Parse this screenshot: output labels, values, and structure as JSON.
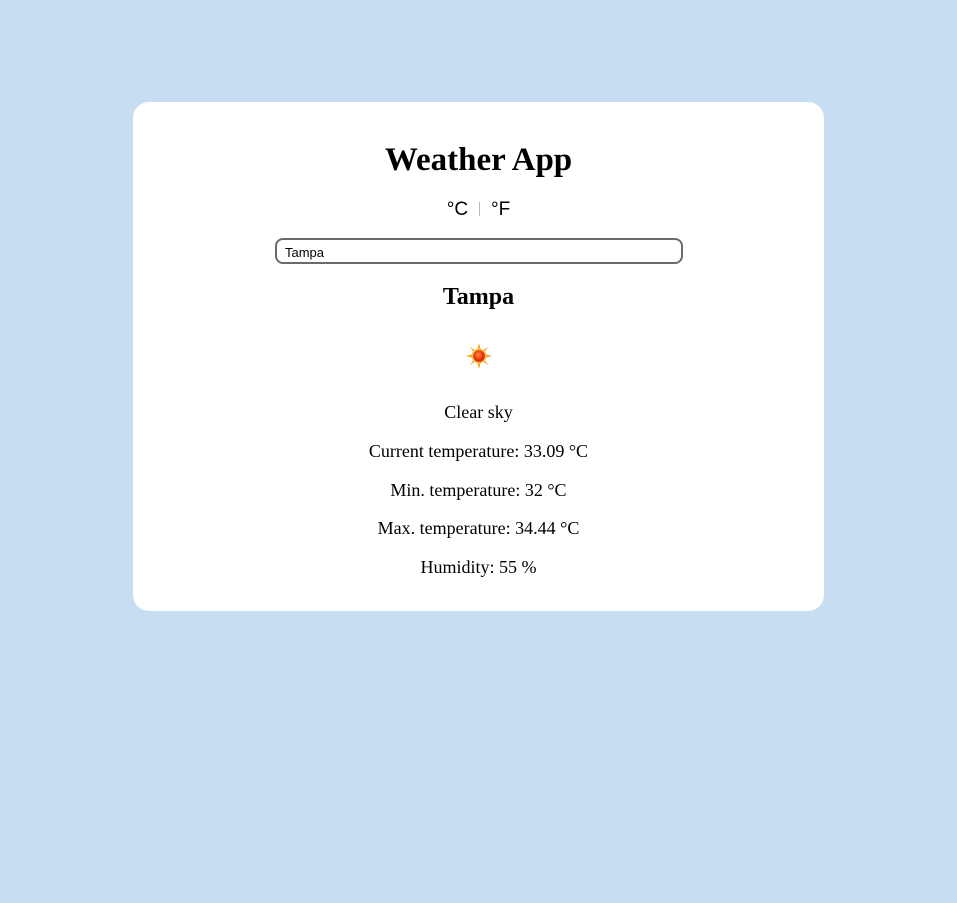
{
  "app": {
    "title": "Weather App"
  },
  "units": {
    "celsius_label": "°C",
    "fahrenheit_label": "°F"
  },
  "search": {
    "value": "Tampa",
    "placeholder": ""
  },
  "weather": {
    "city": "Tampa",
    "icon": "sun-icon",
    "description": "Clear sky",
    "current_temperature": "Current temperature: 33.09 °C",
    "min_temperature": "Min. temperature: 32 °C",
    "max_temperature": "Max. temperature: 34.44 °C",
    "humidity": "Humidity: 55 %"
  },
  "colors": {
    "background": "#c7ddf2",
    "card": "#ffffff",
    "sun_rays": "#f5a623",
    "sun_core": "#e62a12"
  }
}
